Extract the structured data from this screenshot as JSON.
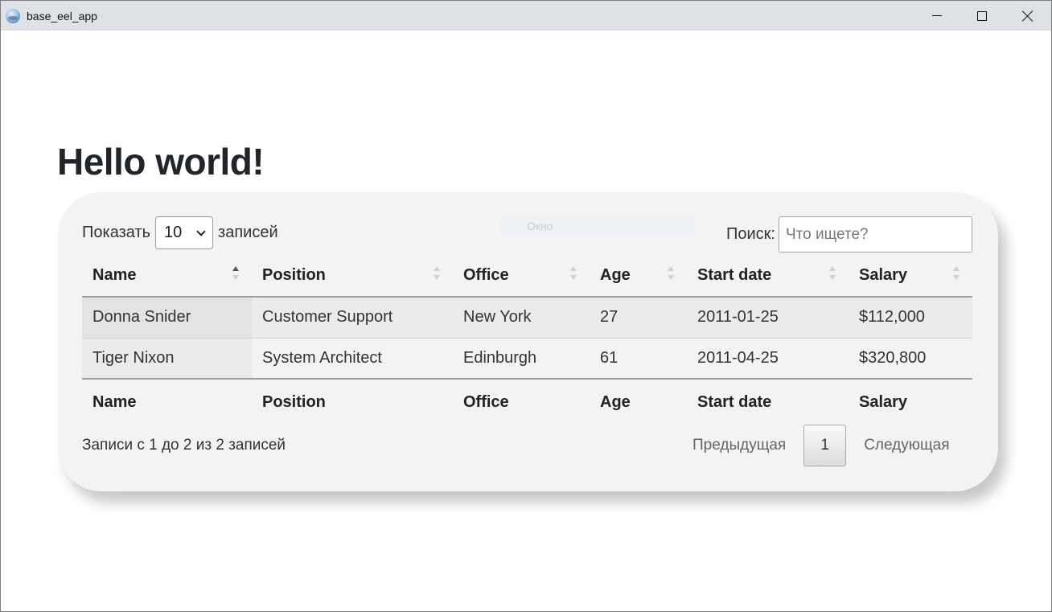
{
  "window": {
    "title": "base_eel_app"
  },
  "page": {
    "heading": "Hello world!"
  },
  "table_controls": {
    "show_label": "Показать",
    "length_value": "10",
    "entries_label": "записей",
    "ghost_label": "Окно",
    "search_label": "Поиск:",
    "search_placeholder": "Что ищете?"
  },
  "table": {
    "columns": [
      "Name",
      "Position",
      "Office",
      "Age",
      "Start date",
      "Salary"
    ],
    "sorted_column": "Name",
    "rows": [
      [
        "Donna Snider",
        "Customer Support",
        "New York",
        "27",
        "2011-01-25",
        "$112,000"
      ],
      [
        "Tiger Nixon",
        "System Architect",
        "Edinburgh",
        "61",
        "2011-04-25",
        "$320,800"
      ]
    ]
  },
  "footer": {
    "info": "Записи с 1 до 2 из 2 записей",
    "prev_label": "Предыдущая",
    "current_page": "1",
    "next_label": "Следующая"
  }
}
